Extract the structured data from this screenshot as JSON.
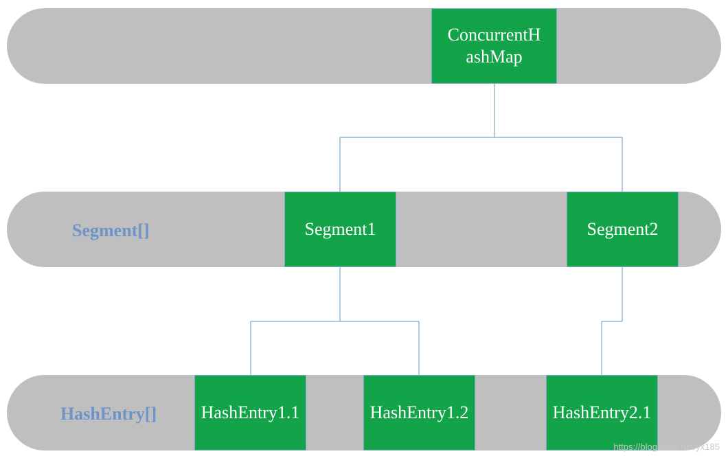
{
  "top": {
    "title_line1": "ConcurrentH",
    "title_line2": "ashMap"
  },
  "row2": {
    "label": "Segment[]",
    "box1": "Segment1",
    "box2": "Segment2"
  },
  "row3": {
    "label": "HashEntry[]",
    "box1": "HashEntry1.1",
    "box2": "HashEntry1.2",
    "box3": "HashEntry2.1"
  },
  "watermark": "https://blog.csdn.net/yx185"
}
